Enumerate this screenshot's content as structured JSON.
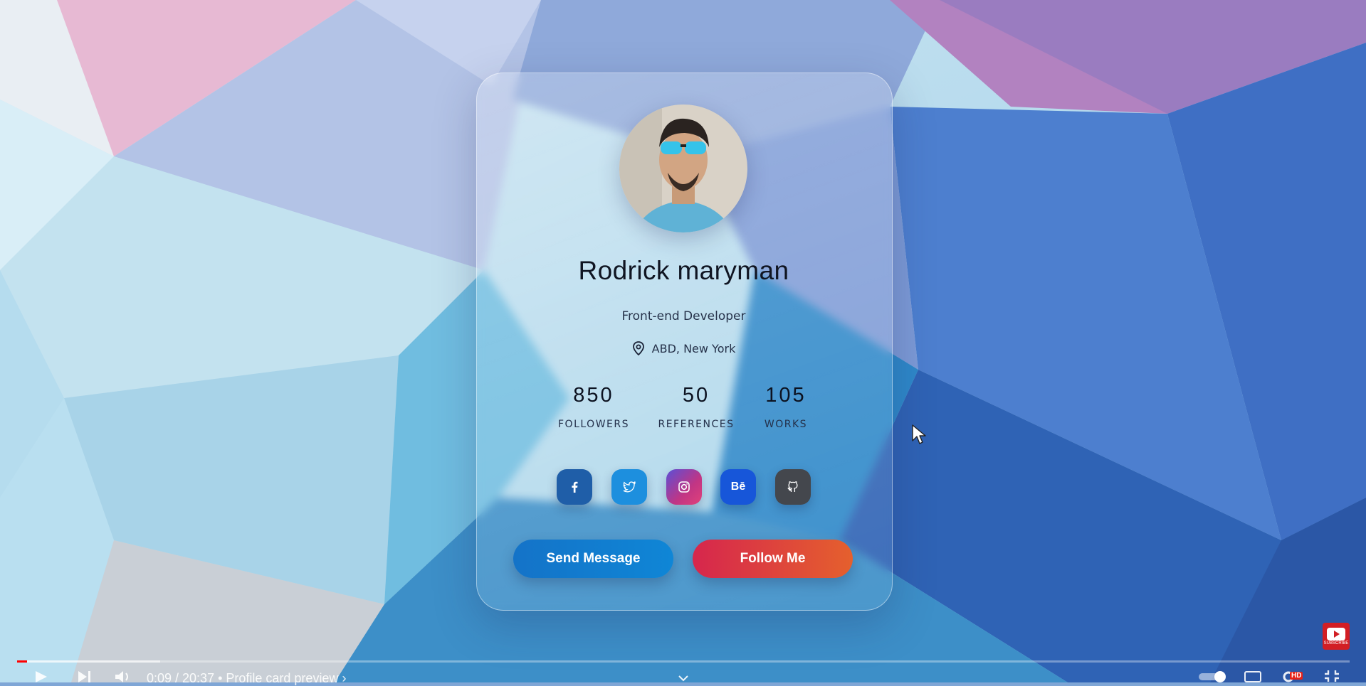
{
  "profile": {
    "name": "Rodrick maryman",
    "role": "Front-end Developer",
    "location": "ABD, New York"
  },
  "stats": [
    {
      "value": "850",
      "label": "FOLLOWERS"
    },
    {
      "value": "50",
      "label": "REFERENCES"
    },
    {
      "value": "105",
      "label": "WORKS"
    }
  ],
  "social": [
    {
      "icon": "facebook-icon",
      "color": "#1f5ea8"
    },
    {
      "icon": "twitter-icon",
      "color": "#1d8fde"
    },
    {
      "icon": "instagram-icon",
      "color": "#c13584"
    },
    {
      "icon": "behance-icon",
      "glyph": "Bē",
      "color": "#1756d9"
    },
    {
      "icon": "github-icon",
      "color": "#44474d"
    }
  ],
  "buttons": {
    "send": "Send Message",
    "follow": "Follow Me"
  },
  "player": {
    "time": "0:09 / 20:37 • Profile card preview ›",
    "progress_fraction": 0.0073,
    "hd_badge": "HD",
    "subscribe": "SUBSCRIBE"
  }
}
